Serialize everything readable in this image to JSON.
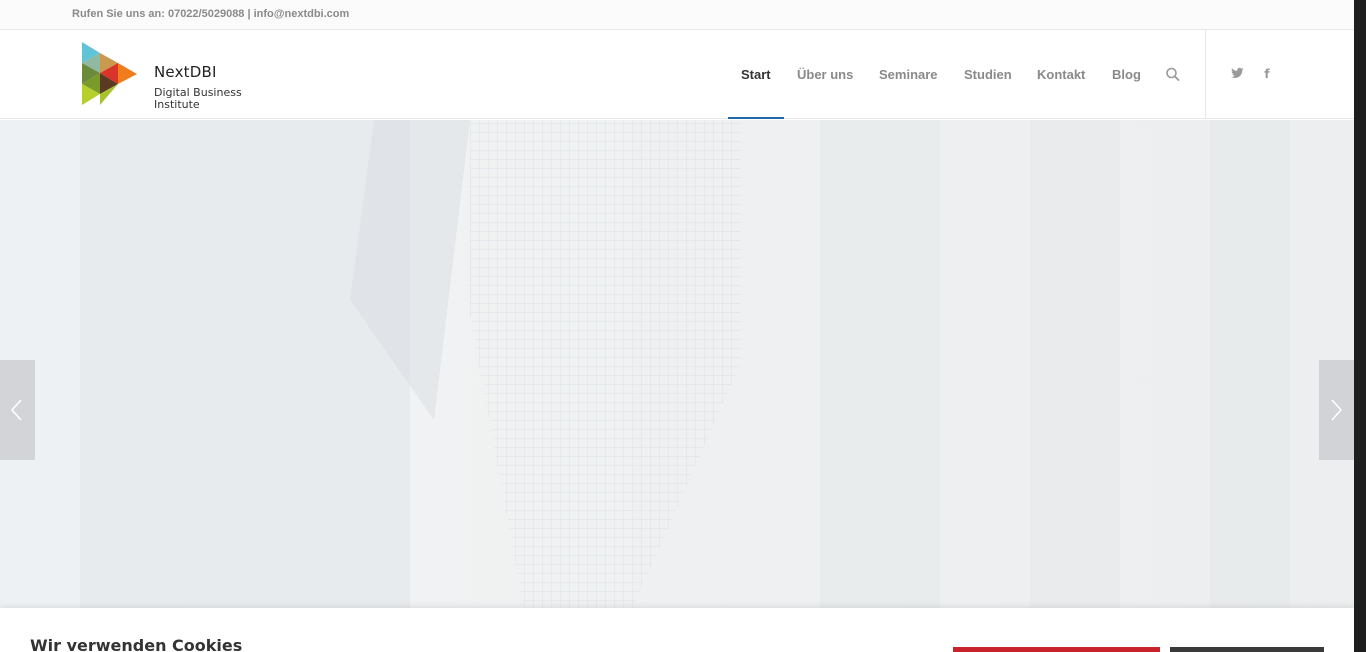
{
  "topbar": {
    "contact": "Rufen Sie uns an: 07022/5029088 | info@nextdbi.com"
  },
  "logo": {
    "brand": "NextDBI",
    "tagline": "Digital Business Institute"
  },
  "nav": {
    "items": [
      {
        "label": "Start",
        "active": true
      },
      {
        "label": "Über uns",
        "active": false
      },
      {
        "label": "Seminare",
        "active": false
      },
      {
        "label": "Studien",
        "active": false
      },
      {
        "label": "Kontakt",
        "active": false
      },
      {
        "label": "Blog",
        "active": false
      }
    ],
    "search_icon": "search-icon"
  },
  "social": {
    "twitter": {
      "icon": "twitter-icon"
    },
    "facebook": {
      "icon": "facebook-icon",
      "glyph": "f"
    }
  },
  "slider": {
    "prev_icon": "chevron-left-icon",
    "next_icon": "chevron-right-icon"
  },
  "cookie_banner": {
    "title": "Wir verwenden Cookies"
  },
  "colors": {
    "accent": "#1f6aa5",
    "accept_button": "#c8222a",
    "settings_button": "#3a3a3a",
    "nav_text": "#8a8a8a",
    "nav_active_text": "#333333"
  }
}
